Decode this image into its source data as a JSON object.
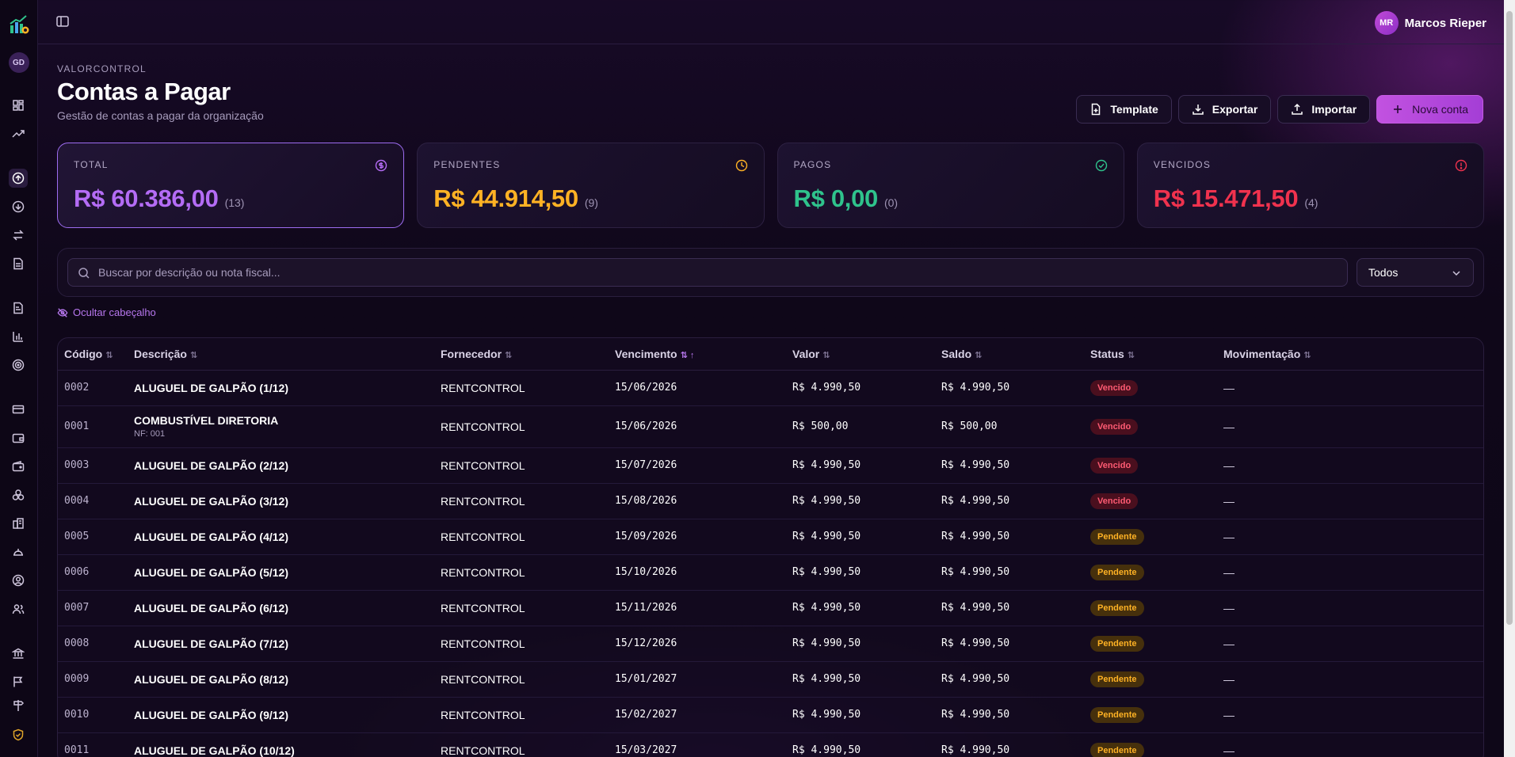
{
  "user": {
    "initials": "MR",
    "name": "Marcos Rieper"
  },
  "org_avatar": "GD",
  "header": {
    "eyebrow": "VALORCONTROL",
    "title": "Contas a Pagar",
    "subtitle": "Gestão de contas a pagar da organização"
  },
  "actions": {
    "template": "Template",
    "export": "Exportar",
    "import": "Importar",
    "new": "Nova conta"
  },
  "cards": [
    {
      "label": "TOTAL",
      "amount": "R$ 60.386,00",
      "count": "(13)",
      "color": "#b46cf5",
      "icon": "dollar-circle-icon"
    },
    {
      "label": "PENDENTES",
      "amount": "R$ 44.914,50",
      "count": "(9)",
      "color": "#ffb224",
      "icon": "clock-icon"
    },
    {
      "label": "PAGOS",
      "amount": "R$ 0,00",
      "count": "(0)",
      "color": "#2fc38c",
      "icon": "check-circle-icon"
    },
    {
      "label": "VENCIDOS",
      "amount": "R$ 15.471,50",
      "count": "(4)",
      "color": "#f0324e",
      "icon": "alert-circle-icon"
    }
  ],
  "filters": {
    "search_placeholder": "Buscar por descrição ou nota fiscal...",
    "status_value": "Todos"
  },
  "hide_header_label": "Ocultar cabeçalho",
  "table": {
    "headers": {
      "code": "Código",
      "desc": "Descrição",
      "supplier": "Fornecedor",
      "due": "Vencimento",
      "value": "Valor",
      "balance": "Saldo",
      "status": "Status",
      "movement": "Movimentação"
    },
    "rows": [
      {
        "code": "0002",
        "desc": "ALUGUEL DE GALPÃO (1/12)",
        "nf": "",
        "supplier": "RENTCONTROL",
        "due": "15/06/2026",
        "value": "R$ 4.990,50",
        "balance": "R$ 4.990,50",
        "status": "Vencido",
        "movement": "—"
      },
      {
        "code": "0001",
        "desc": "COMBUSTÍVEL DIRETORIA",
        "nf": "NF: 001",
        "supplier": "RENTCONTROL",
        "due": "15/06/2026",
        "value": "R$ 500,00",
        "balance": "R$ 500,00",
        "status": "Vencido",
        "movement": "—"
      },
      {
        "code": "0003",
        "desc": "ALUGUEL DE GALPÃO (2/12)",
        "nf": "",
        "supplier": "RENTCONTROL",
        "due": "15/07/2026",
        "value": "R$ 4.990,50",
        "balance": "R$ 4.990,50",
        "status": "Vencido",
        "movement": "—"
      },
      {
        "code": "0004",
        "desc": "ALUGUEL DE GALPÃO (3/12)",
        "nf": "",
        "supplier": "RENTCONTROL",
        "due": "15/08/2026",
        "value": "R$ 4.990,50",
        "balance": "R$ 4.990,50",
        "status": "Vencido",
        "movement": "—"
      },
      {
        "code": "0005",
        "desc": "ALUGUEL DE GALPÃO (4/12)",
        "nf": "",
        "supplier": "RENTCONTROL",
        "due": "15/09/2026",
        "value": "R$ 4.990,50",
        "balance": "R$ 4.990,50",
        "status": "Pendente",
        "movement": "—"
      },
      {
        "code": "0006",
        "desc": "ALUGUEL DE GALPÃO (5/12)",
        "nf": "",
        "supplier": "RENTCONTROL",
        "due": "15/10/2026",
        "value": "R$ 4.990,50",
        "balance": "R$ 4.990,50",
        "status": "Pendente",
        "movement": "—"
      },
      {
        "code": "0007",
        "desc": "ALUGUEL DE GALPÃO (6/12)",
        "nf": "",
        "supplier": "RENTCONTROL",
        "due": "15/11/2026",
        "value": "R$ 4.990,50",
        "balance": "R$ 4.990,50",
        "status": "Pendente",
        "movement": "—"
      },
      {
        "code": "0008",
        "desc": "ALUGUEL DE GALPÃO (7/12)",
        "nf": "",
        "supplier": "RENTCONTROL",
        "due": "15/12/2026",
        "value": "R$ 4.990,50",
        "balance": "R$ 4.990,50",
        "status": "Pendente",
        "movement": "—"
      },
      {
        "code": "0009",
        "desc": "ALUGUEL DE GALPÃO (8/12)",
        "nf": "",
        "supplier": "RENTCONTROL",
        "due": "15/01/2027",
        "value": "R$ 4.990,50",
        "balance": "R$ 4.990,50",
        "status": "Pendente",
        "movement": "—"
      },
      {
        "code": "0010",
        "desc": "ALUGUEL DE GALPÃO (9/12)",
        "nf": "",
        "supplier": "RENTCONTROL",
        "due": "15/02/2027",
        "value": "R$ 4.990,50",
        "balance": "R$ 4.990,50",
        "status": "Pendente",
        "movement": "—"
      },
      {
        "code": "0011",
        "desc": "ALUGUEL DE GALPÃO (10/12)",
        "nf": "",
        "supplier": "RENTCONTROL",
        "due": "15/03/2027",
        "value": "R$ 4.990,50",
        "balance": "R$ 4.990,50",
        "status": "Pendente",
        "movement": "—"
      }
    ]
  }
}
